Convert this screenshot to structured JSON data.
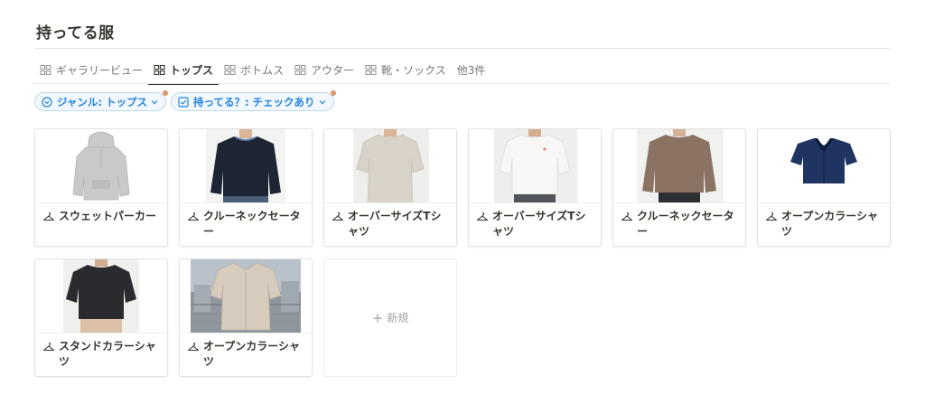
{
  "page": {
    "title": "持ってる服"
  },
  "tabs": [
    {
      "label": "ギャラリービュー",
      "active": false
    },
    {
      "label": "トップス",
      "active": true
    },
    {
      "label": "ボトムス",
      "active": false
    },
    {
      "label": "アウター",
      "active": false
    },
    {
      "label": "靴・ソックス",
      "active": false
    }
  ],
  "more_tabs": "他3件",
  "filters": [
    {
      "label": "ジャンル: トップス",
      "icon": "circle-chevron-icon"
    },
    {
      "label": "持ってる？: チェックあり",
      "icon": "checkbox-icon"
    }
  ],
  "cards": [
    {
      "title": "スウェットパーカー",
      "item": "hoodie",
      "garment_color": "#c9cac7",
      "background": "#ffffff"
    },
    {
      "title": "クルーネックセーター",
      "item": "sweater-dark",
      "garment_color": "#1d2433",
      "background": "#f3f3f2"
    },
    {
      "title": "オーバーサイズTシャツ",
      "item": "tee-beige",
      "garment_color": "#d9d2c8",
      "background": "#eeeeec"
    },
    {
      "title": "オーバーサイズTシャツ",
      "item": "tee-white",
      "garment_color": "#f7f7f5",
      "background": "#eeeeec"
    },
    {
      "title": "クルーネックセーター",
      "item": "sweater-brown",
      "garment_color": "#8a7362",
      "background": "#f1f1f0"
    },
    {
      "title": "オープンカラーシャツ",
      "item": "shirt-navy",
      "garment_color": "#1f3461",
      "background": "#ffffff"
    },
    {
      "title": "スタンドカラーシャツ",
      "item": "shirt-black",
      "garment_color": "#2a2b2e",
      "background": "#efefee"
    },
    {
      "title": "オープンカラーシャツ",
      "item": "shirt-beige",
      "garment_color": "#d6cbbc",
      "background": "#b9c2cb"
    }
  ],
  "new_card": {
    "label": "新規"
  }
}
